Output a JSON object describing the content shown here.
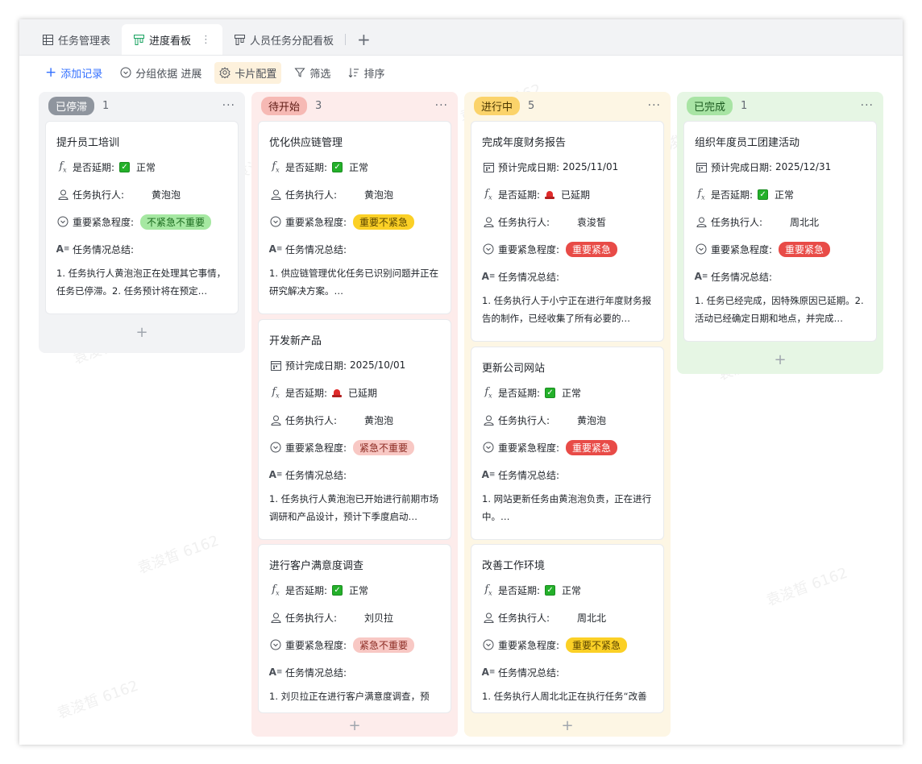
{
  "tabs": [
    {
      "label": "任务管理表",
      "icon": "table-grid-icon"
    },
    {
      "label": "进度看板",
      "icon": "kanban-icon"
    },
    {
      "label": "人员任务分配看板",
      "icon": "kanban-icon"
    }
  ],
  "toolbar": {
    "add_record": "添加记录",
    "group_by": "分组依据 进展",
    "card_config": "卡片配置",
    "filter": "筛选",
    "sort": "排序"
  },
  "fields": {
    "due": "预计完成日期:",
    "delayed": "是否延期:",
    "assignee": "任务执行人:",
    "priority": "重要紧急程度:",
    "summary": "任务情况总结:"
  },
  "columns": [
    {
      "label": "已停滞",
      "count": "1",
      "more": "···",
      "cards": [
        {
          "title": "提升员工培训",
          "delayed": "正常",
          "assignee": "黄泡泡",
          "priority": "不紧急不重要",
          "summary": "1. 任务执行人黄泡泡正在处理其它事情，任务已停滞。2. 任务预计将在预定…"
        }
      ]
    },
    {
      "label": "待开始",
      "count": "3",
      "more": "···",
      "cards": [
        {
          "title": "优化供应链管理",
          "delayed": "正常",
          "assignee": "黄泡泡",
          "priority": "重要不紧急",
          "summary": "1. 供应链管理优化任务已识别问题并正在研究解决方案。…"
        },
        {
          "title": "开发新产品",
          "due": "2025/10/01",
          "delayed": "已延期",
          "assignee": "黄泡泡",
          "priority": "紧急不重要",
          "summary": "1. 任务执行人黄泡泡已开始进行前期市场调研和产品设计，预计下季度启动…"
        },
        {
          "title": "进行客户满意度调查",
          "delayed": "正常",
          "assignee": "刘贝拉",
          "priority": "紧急不重要",
          "summary": "1. 刘贝拉正在进行客户满意度调查，预"
        }
      ]
    },
    {
      "label": "进行中",
      "count": "5",
      "more": "···",
      "cards": [
        {
          "title": "完成年度财务报告",
          "due": "2025/11/01",
          "delayed": "已延期",
          "assignee": "袁浚皙",
          "priority": "重要紧急",
          "summary": "1. 任务执行人于小宁正在进行年度财务报告的制作，已经收集了所有必要的…"
        },
        {
          "title": "更新公司网站",
          "delayed": "正常",
          "assignee": "黄泡泡",
          "priority": "重要紧急",
          "summary": "1. 网站更新任务由黄泡泡负责，正在进行中。…"
        },
        {
          "title": "改善工作环境",
          "delayed": "正常",
          "assignee": "周北北",
          "priority": "重要不紧急",
          "summary": "1. 任务执行人周北北正在执行任务“改善"
        }
      ]
    },
    {
      "label": "已完成",
      "count": "1",
      "more": "···",
      "cards": [
        {
          "title": "组织年度员工团建活动",
          "due": "2025/12/31",
          "delayed": "正常",
          "assignee": "周北北",
          "priority": "重要紧急",
          "summary": "1. 任务已经完成，因特殊原因已延期。2. 活动已经确定日期和地点，并完成…"
        }
      ]
    }
  ],
  "add_card_symbol": "+",
  "watermark": "袁浚皙 6162"
}
